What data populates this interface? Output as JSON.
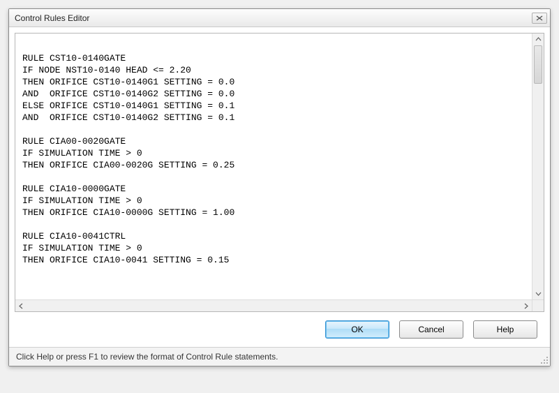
{
  "window": {
    "title": "Control Rules Editor"
  },
  "editor": {
    "text": "\nRULE CST10-0140GATE\nIF NODE NST10-0140 HEAD <= 2.20\nTHEN ORIFICE CST10-0140G1 SETTING = 0.0\nAND  ORIFICE CST10-0140G2 SETTING = 0.0\nELSE ORIFICE CST10-0140G1 SETTING = 0.1\nAND  ORIFICE CST10-0140G2 SETTING = 0.1\n\nRULE CIA00-0020GATE\nIF SIMULATION TIME > 0\nTHEN ORIFICE CIA00-0020G SETTING = 0.25\n\nRULE CIA10-0000GATE\nIF SIMULATION TIME > 0\nTHEN ORIFICE CIA10-0000G SETTING = 1.00\n\nRULE CIA10-0041CTRL\nIF SIMULATION TIME > 0\nTHEN ORIFICE CIA10-0041 SETTING = 0.15"
  },
  "buttons": {
    "ok": "OK",
    "cancel": "Cancel",
    "help": "Help"
  },
  "statusbar": {
    "hint": "Click Help or press F1 to review the format of Control Rule statements."
  },
  "icons": {
    "close": "close-icon",
    "arrow_up": "chevron-up-icon",
    "arrow_down": "chevron-down-icon",
    "arrow_left": "chevron-left-icon",
    "arrow_right": "chevron-right-icon"
  }
}
